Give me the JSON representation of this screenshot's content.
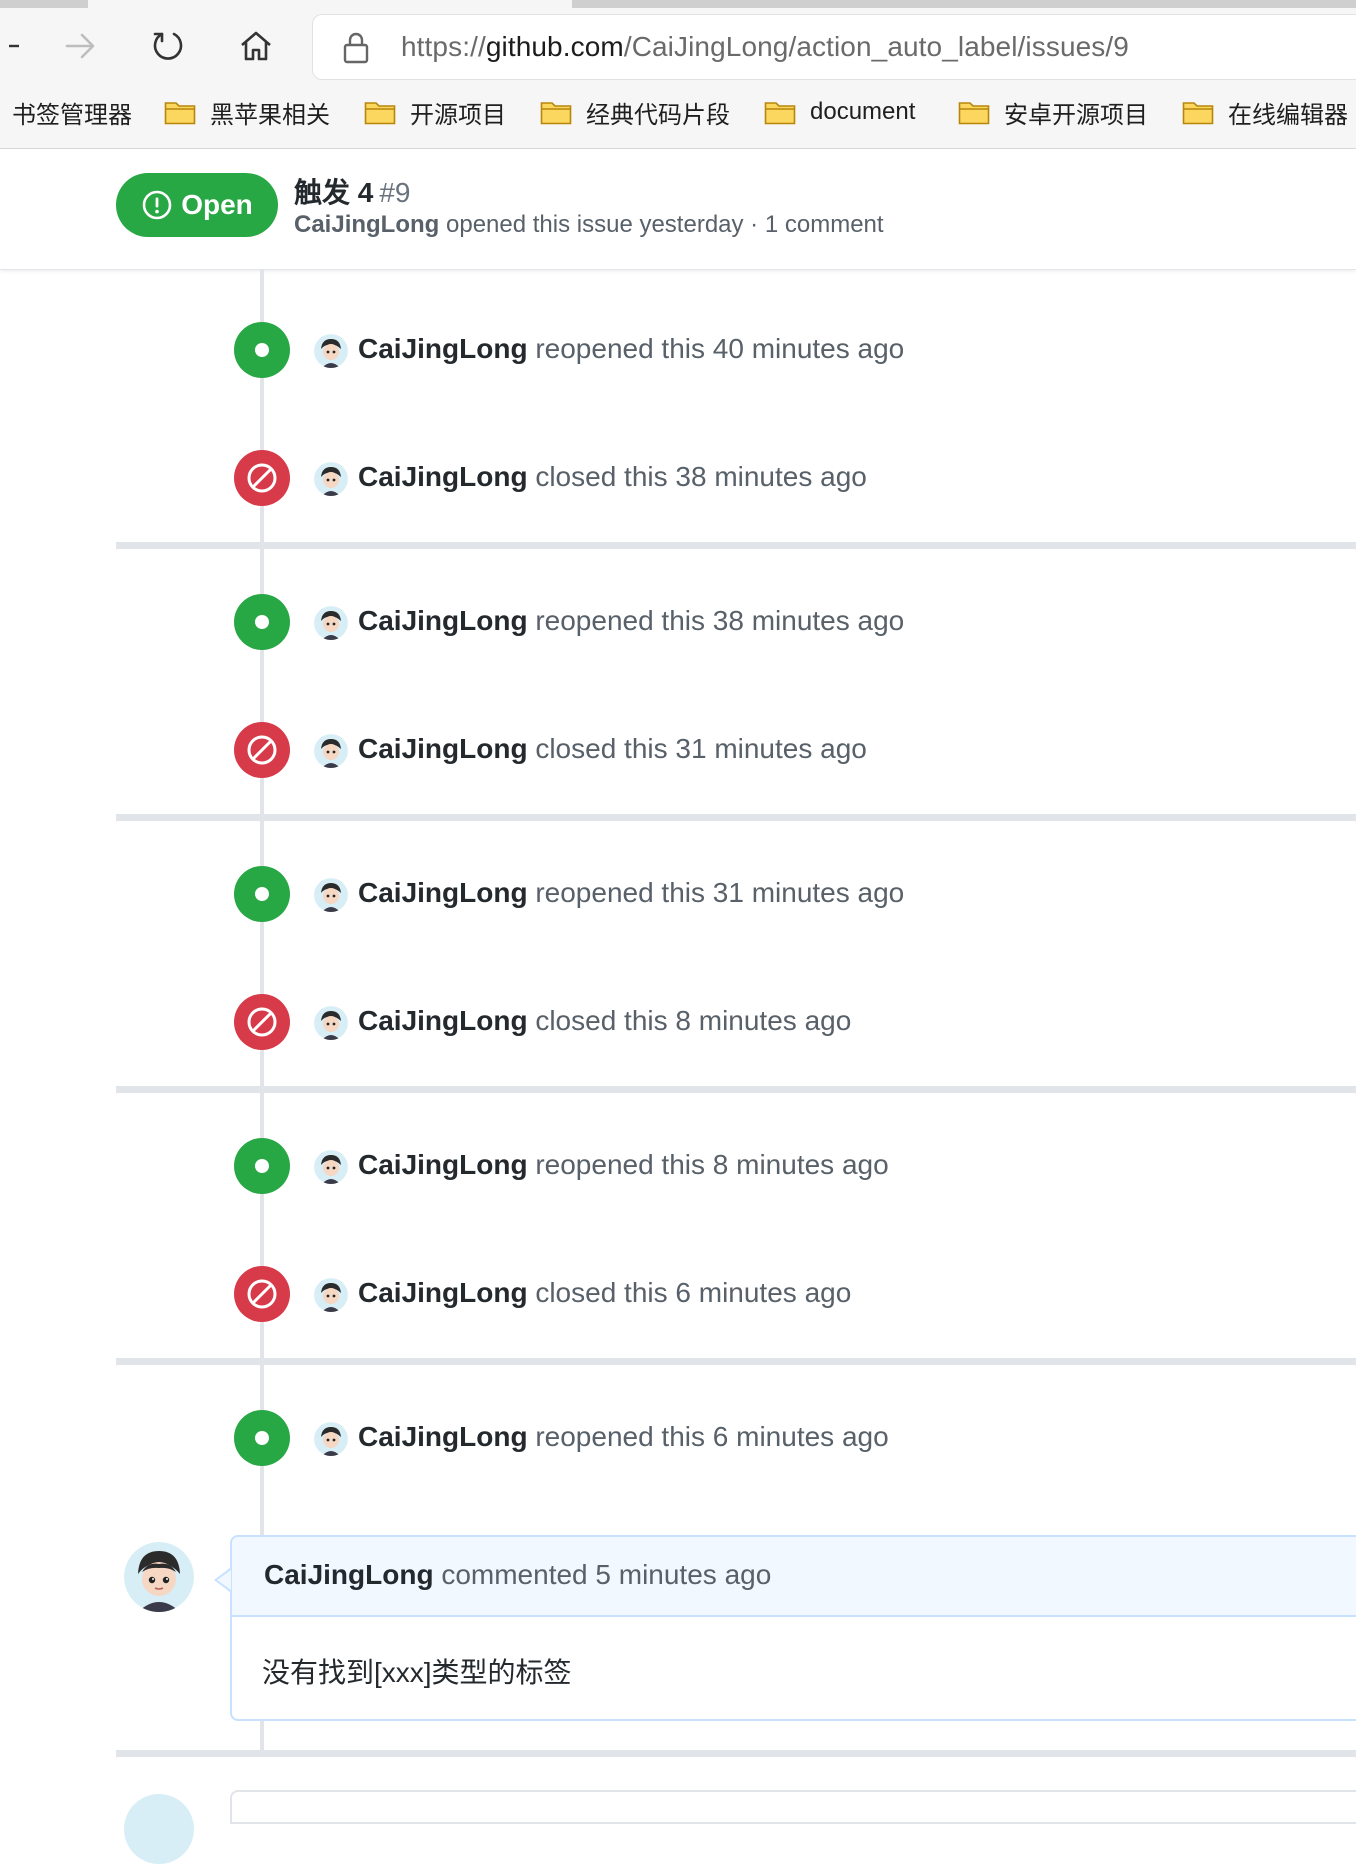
{
  "browser": {
    "url_prefix": "https://",
    "url_host": "github.com",
    "url_path": "/CaiJingLong/action_auto_label/issues/9",
    "bookmarks": [
      "书签管理器",
      "黑苹果相关",
      "开源项目",
      "经典代码片段",
      "document",
      "安卓开源项目",
      "在线编辑器"
    ]
  },
  "issue": {
    "state": "Open",
    "title": "触发 4",
    "number": "#9",
    "author": "CaiJingLong",
    "meta": " opened this issue yesterday · 1 comment"
  },
  "events": [
    {
      "actor": "CaiJingLong",
      "text": " reopened this 40 minutes ago",
      "type": "reopened"
    },
    {
      "actor": "CaiJingLong",
      "text": " closed this 38 minutes ago",
      "type": "closed"
    },
    {
      "actor": "CaiJingLong",
      "text": " reopened this 38 minutes ago",
      "type": "reopened"
    },
    {
      "actor": "CaiJingLong",
      "text": " closed this 31 minutes ago",
      "type": "closed"
    },
    {
      "actor": "CaiJingLong",
      "text": " reopened this 31 minutes ago",
      "type": "reopened"
    },
    {
      "actor": "CaiJingLong",
      "text": " closed this 8 minutes ago",
      "type": "closed"
    },
    {
      "actor": "CaiJingLong",
      "text": " reopened this 8 minutes ago",
      "type": "reopened"
    },
    {
      "actor": "CaiJingLong",
      "text": " closed this 6 minutes ago",
      "type": "closed"
    },
    {
      "actor": "CaiJingLong",
      "text": " reopened this 6 minutes ago",
      "type": "reopened"
    }
  ],
  "comment": {
    "author": "CaiJingLong",
    "meta": " commented 5 minutes ago",
    "body": "没有找到[xxx]类型的标签"
  },
  "colors": {
    "open": "#28a745",
    "closed": "#d73a49",
    "comment_header": "#f1f8ff",
    "comment_border": "#c8e1ff"
  }
}
